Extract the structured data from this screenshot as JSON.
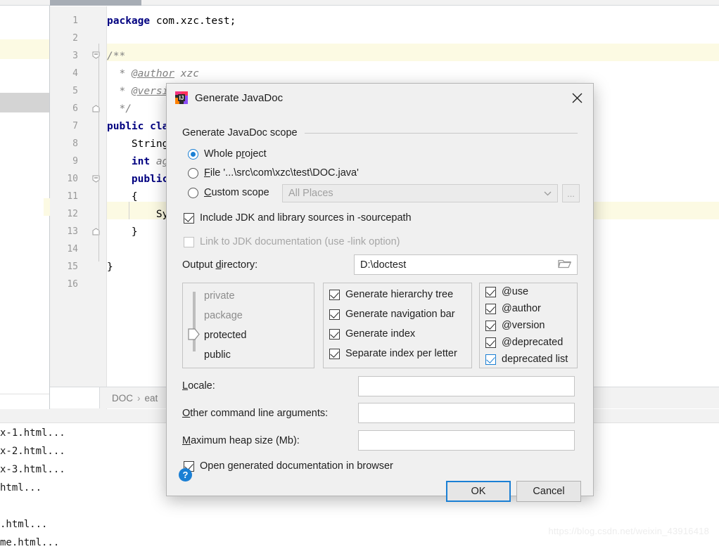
{
  "ide": {
    "editor": {
      "line_numbers": [
        "1",
        "2",
        "3",
        "4",
        "5",
        "6",
        "7",
        "8",
        "9",
        "10",
        "11",
        "12",
        "13",
        "14",
        "15",
        "16"
      ],
      "lines": [
        {
          "n": 1,
          "segments": [
            {
              "t": "package",
              "c": "kw"
            },
            {
              "t": " com.xzc.test;",
              "c": "plain"
            }
          ]
        },
        {
          "n": 2,
          "segments": []
        },
        {
          "n": 3,
          "segments": [
            {
              "t": "/**",
              "c": "cmt"
            }
          ]
        },
        {
          "n": 4,
          "segments": [
            {
              "t": "  * ",
              "c": "cmt"
            },
            {
              "t": "@author",
              "c": "tag"
            },
            {
              "t": " xzc",
              "c": "cmt"
            }
          ]
        },
        {
          "n": 5,
          "segments": [
            {
              "t": "  * ",
              "c": "cmt"
            },
            {
              "t": "@versio",
              "c": "tag"
            }
          ]
        },
        {
          "n": 6,
          "segments": [
            {
              "t": "  */",
              "c": "cmt"
            }
          ]
        },
        {
          "n": 7,
          "segments": [
            {
              "t": "public cla",
              "c": "kw"
            }
          ]
        },
        {
          "n": 8,
          "segments": [
            {
              "t": "    String",
              "c": "plain"
            }
          ]
        },
        {
          "n": 9,
          "segments": [
            {
              "t": "    int",
              "c": "kw"
            },
            {
              "t": " ag",
              "c": "plain"
            }
          ]
        },
        {
          "n": 10,
          "segments": [
            {
              "t": "    public",
              "c": "kw"
            }
          ]
        },
        {
          "n": 11,
          "segments": [
            {
              "t": "    {",
              "c": "plain"
            }
          ]
        },
        {
          "n": 12,
          "segments": [
            {
              "t": "        Sy",
              "c": "plain"
            }
          ]
        },
        {
          "n": 13,
          "segments": [
            {
              "t": "    }",
              "c": "plain"
            }
          ]
        },
        {
          "n": 14,
          "segments": []
        },
        {
          "n": 15,
          "segments": [
            {
              "t": "}",
              "c": "plain"
            }
          ]
        },
        {
          "n": 16,
          "segments": []
        }
      ]
    },
    "breadcrumb": {
      "root": "DOC",
      "separator": "›",
      "leaf": "eat"
    },
    "console": {
      "lines": [
        "x-1.html...",
        "x-2.html...",
        "x-3.html...",
        "html...",
        "",
        ".html...",
        "me.html..."
      ]
    },
    "watermark": "https://blog.csdn.net/weixin_43916418"
  },
  "dialog": {
    "title": "Generate JavaDoc",
    "icon": "intellij-idea-icon",
    "close_icon": "close-icon",
    "scope": {
      "group_label": "Generate JavaDoc scope",
      "options": [
        {
          "label": "Whole project",
          "underline_index": 6,
          "checked": true
        },
        {
          "label": "File '...\\src\\com\\xzc\\test\\DOC.java'",
          "underline_index": 0,
          "checked": false
        },
        {
          "label": "Custom scope",
          "underline_index": 0,
          "checked": false
        }
      ],
      "custom_scope_value": "All Places",
      "custom_scope_browse_label": "...",
      "chevron_icon": "chevron-down-icon"
    },
    "sources": {
      "include_jdk": {
        "label": "Include JDK and library sources in -sourcepath",
        "checked": true,
        "enabled": true
      },
      "link_jdk": {
        "label": "Link to JDK documentation (use -link option)",
        "checked": false,
        "enabled": false
      }
    },
    "output": {
      "label": "Output directory:",
      "value": "D:\\doctest",
      "browse_icon": "folder-icon"
    },
    "visibility": {
      "levels": [
        "private",
        "package",
        "protected",
        "public"
      ],
      "selected": "protected"
    },
    "generate_options": [
      {
        "label": "Generate hierarchy tree",
        "checked": true
      },
      {
        "label": "Generate navigation bar",
        "checked": true
      },
      {
        "label": "Generate index",
        "checked": true
      },
      {
        "label": "Separate index per letter",
        "checked": true
      }
    ],
    "tag_options": [
      {
        "label": "@use",
        "checked": true,
        "focused": false
      },
      {
        "label": "@author",
        "checked": true,
        "focused": false
      },
      {
        "label": "@version",
        "checked": true,
        "focused": false
      },
      {
        "label": "@deprecated",
        "checked": true,
        "focused": false
      },
      {
        "label": "deprecated list",
        "checked": true,
        "focused": true
      }
    ],
    "fields": [
      {
        "label": "Locale:",
        "value": ""
      },
      {
        "label": "Other command line arguments:",
        "value": ""
      },
      {
        "label": "Maximum heap size (Mb):",
        "value": ""
      }
    ],
    "open_in_browser": {
      "label": "Open generated documentation in browser",
      "checked": true
    },
    "buttons": {
      "help": "?",
      "ok": "OK",
      "cancel": "Cancel"
    },
    "colors": {
      "accent": "#1a7fd4",
      "bg": "#f0f0f0",
      "field_bg": "#ffffff"
    }
  }
}
